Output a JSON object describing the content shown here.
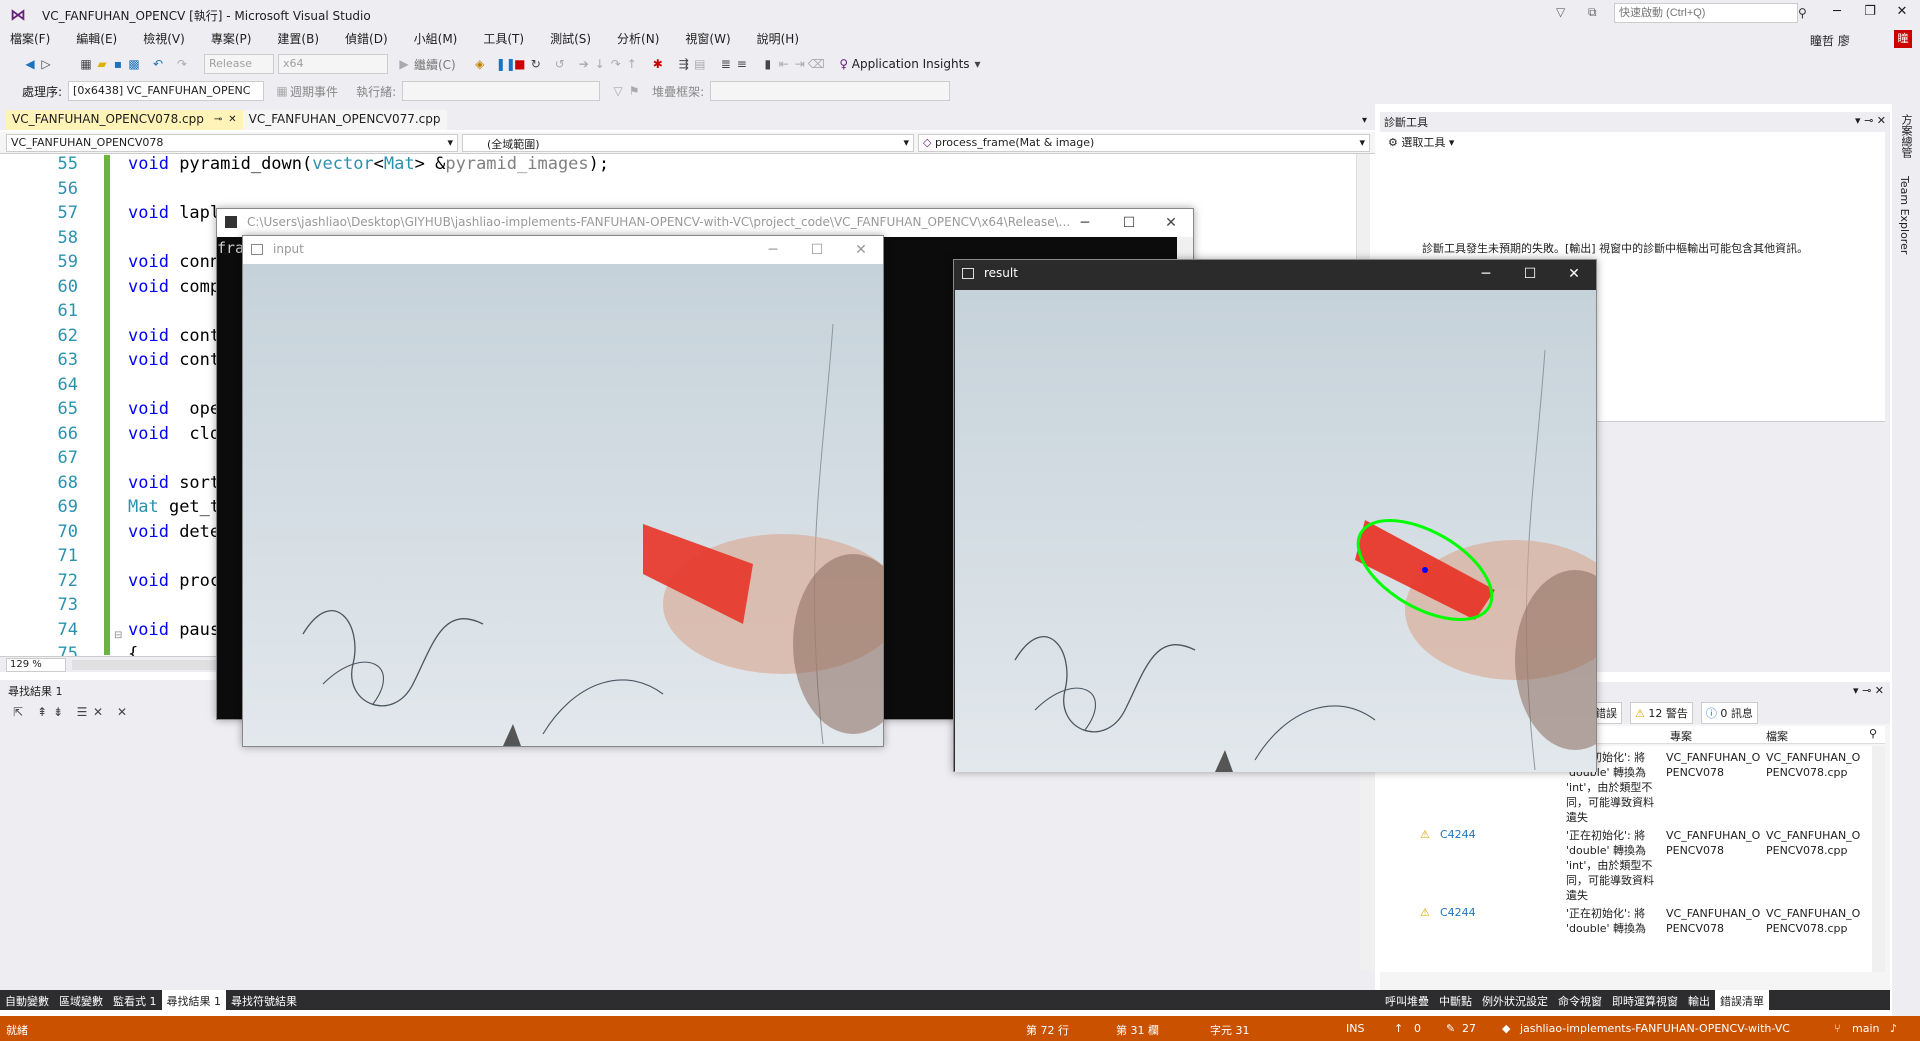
{
  "window": {
    "title": "VC_FANFUHAN_OPENCV [執行] - Microsoft Visual Studio",
    "quick_launch_placeholder": "快速啟動 (Ctrl+Q)",
    "user": "瞳哲 廖",
    "avatar_text": "瞳"
  },
  "menu": [
    "檔案(F)",
    "編輯(E)",
    "檢視(V)",
    "專案(P)",
    "建置(B)",
    "偵錯(D)",
    "小組(M)",
    "工具(T)",
    "測試(S)",
    "分析(N)",
    "視窗(W)",
    "說明(H)"
  ],
  "toolbar": {
    "config": "Release",
    "platform": "x64",
    "continue_label": "繼續(C)",
    "app_insights": "Application Insights",
    "process_label": "處理序:",
    "process_value": "[0x6438] VC_FANFUHAN_OPENC",
    "lifecycle_label": "週期事件",
    "thread_label": "執行緒:",
    "stack_label": "堆疊框架:"
  },
  "tabs": [
    {
      "label": "VC_FANFUHAN_OPENCV078.cpp",
      "active": true
    },
    {
      "label": "VC_FANFUHAN_OPENCV077.cpp",
      "active": false
    }
  ],
  "nav": {
    "project": "VC_FANFUHAN_OPENCV078",
    "scope": "(全域範圍)",
    "member": "process_frame(Mat & image)"
  },
  "code_lines": [
    {
      "n": "55",
      "html": "<span class='kw'>void</span> pyramid_down(<span class='ty'>vector</span>&lt;<span class='ty'>Mat</span>&gt; &amp;<span class='pm'>pyramid_images</span>);"
    },
    {
      "n": "56",
      "html": ""
    },
    {
      "n": "57",
      "html": "<span class='kw'>void</span> lapl"
    },
    {
      "n": "58",
      "html": ""
    },
    {
      "n": "59",
      "html": "<span class='kw'>void</span> conn"
    },
    {
      "n": "60",
      "html": "<span class='kw'>void</span> comp"
    },
    {
      "n": "61",
      "html": ""
    },
    {
      "n": "62",
      "html": "<span class='kw'>void</span> cont"
    },
    {
      "n": "63",
      "html": "<span class='kw'>void</span> cont"
    },
    {
      "n": "64",
      "html": ""
    },
    {
      "n": "65",
      "html": "<span class='kw'>void</span>  ope"
    },
    {
      "n": "66",
      "html": "<span class='kw'>void</span>  clo"
    },
    {
      "n": "67",
      "html": ""
    },
    {
      "n": "68",
      "html": "<span class='kw'>void</span> sort"
    },
    {
      "n": "69",
      "html": "<span class='ty'>Mat</span> get_t"
    },
    {
      "n": "70",
      "html": "<span class='kw'>void</span> dete"
    },
    {
      "n": "71",
      "html": ""
    },
    {
      "n": "72",
      "html": "<span class='kw'>void</span> proc"
    },
    {
      "n": "73",
      "html": ""
    },
    {
      "n": "74",
      "html": "<span class='kw'>void</span> paus"
    },
    {
      "n": "75",
      "html": "{"
    }
  ],
  "zoom": "129 %",
  "find_results": {
    "title": "尋找結果 1"
  },
  "bottom_tabs": [
    {
      "label": "自動變數",
      "active": false
    },
    {
      "label": "區域變數",
      "active": false
    },
    {
      "label": "監看式 1",
      "active": false
    },
    {
      "label": "尋找結果 1",
      "active": true
    },
    {
      "label": "尋找符號結果",
      "active": false
    }
  ],
  "diag": {
    "title": "診斷工具",
    "select_tool": "選取工具",
    "message": "診斷工具發生未預期的失敗。[輸出] 視窗中的診斷中樞輸出可能包含其他資訊。"
  },
  "right_sidebar": [
    "方案總管",
    "Team Explorer"
  ],
  "error_list": {
    "errors_label": "錯誤",
    "warnings": "12 警告",
    "messages": "0 訊息",
    "col_project": "專案",
    "col_file": "檔案",
    "rows": [
      {
        "code": "C4244",
        "desc": "'正在初始化': 將 'double' 轉換為 'int'，由於類型不同，可能導致資料遺失",
        "project": "VC_FANFUHAN_OPENCV078",
        "file": "VC_FANFUHAN_OPENCV078.cpp"
      },
      {
        "code": "C4244",
        "desc": "'正在初始化': 將 'double' 轉換為 'int'，由於類型不同，可能導致資料遺失",
        "project": "VC_FANFUHAN_OPENCV078",
        "file": "VC_FANFUHAN_OPENCV078.cpp"
      },
      {
        "code": "C4244",
        "desc": "'正在初始化': 將 'double' 轉換為",
        "project": "VC_FANFUHAN_OPENCV078",
        "file": "VC_FANFUHAN_OPENCV078.cpp"
      }
    ]
  },
  "err_tabs": [
    {
      "label": "呼叫堆疊",
      "active": false
    },
    {
      "label": "中斷點",
      "active": false
    },
    {
      "label": "例外狀況設定",
      "active": false
    },
    {
      "label": "命令視窗",
      "active": false
    },
    {
      "label": "即時運算視窗",
      "active": false
    },
    {
      "label": "輸出",
      "active": false
    },
    {
      "label": "錯誤清單",
      "active": true
    }
  ],
  "status": {
    "ready": "就緒",
    "line": "第 72 行",
    "col": "第 31 欄",
    "char": "字元 31",
    "ins": "INS",
    "up": "0",
    "edits": "27",
    "repo": "jashliao-implements-FANFUHAN-OPENCV-with-VC",
    "branch": "main"
  },
  "console_window": {
    "title": "C:\\Users\\jashliao\\Desktop\\GIYHUB\\jashliao-implements-FANFUHAN-OPENCV-with-VC\\project_code\\VC_FANFUHAN_OPENCV\\x64\\Release\\...",
    "text": "fra"
  },
  "input_window": {
    "title": "input"
  },
  "result_window": {
    "title": "result"
  },
  "colors": {
    "accent": "#68217a",
    "status": "#ca5100",
    "ellipse": "#00ff00",
    "object": "#e8372b"
  }
}
